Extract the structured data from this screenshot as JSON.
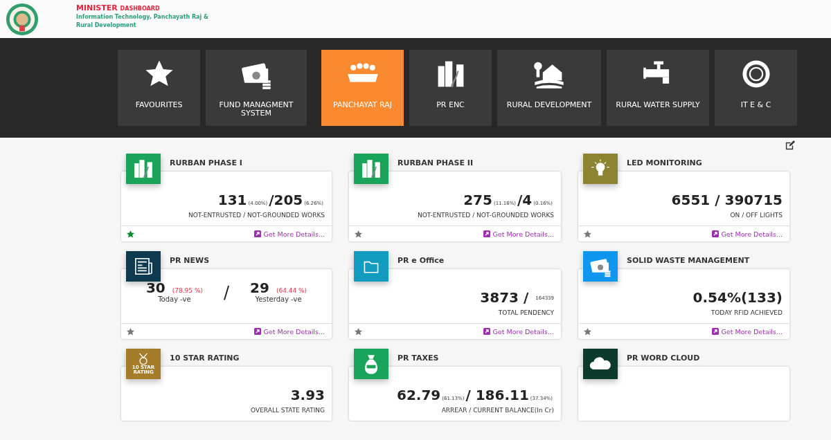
{
  "header": {
    "title": "MINISTER",
    "title_suffix": "DASHBOARD",
    "subtitle": "Information Technology, Panchayath Raj & Rural Development"
  },
  "modules": [
    {
      "label": "FAVOURITES",
      "selected": false
    },
    {
      "label": "FUND MANAGMENT SYSTEM",
      "selected": false
    },
    {
      "label": "PANCHAYAT RAJ",
      "selected": true
    },
    {
      "label": "PR ENC",
      "selected": false
    },
    {
      "label": "RURAL DEVELOPMENT",
      "selected": false
    },
    {
      "label": "RURAL WATER SUPPLY",
      "selected": false
    },
    {
      "label": "IT E & C",
      "selected": false
    }
  ],
  "cards": [
    {
      "title": "RURBAN PHASE I",
      "color": "#1aa45a",
      "figures": [
        {
          "text": "131",
          "kind": "big"
        },
        {
          "text": "(4.00%)",
          "kind": "note"
        },
        {
          "text": "/205",
          "kind": "big"
        },
        {
          "text": "(6.26%)",
          "kind": "note"
        }
      ],
      "caption": "NOT-ENTRUSTED / NOT-GROUNDED WORKS",
      "favourite": true,
      "link": "Get More Details..."
    },
    {
      "title": "RURBAN PHASE II",
      "color": "#1aa45a",
      "figures": [
        {
          "text": "275",
          "kind": "big"
        },
        {
          "text": "(11.16%)",
          "kind": "note"
        },
        {
          "text": "/4",
          "kind": "big"
        },
        {
          "text": "(0.16%)",
          "kind": "note"
        }
      ],
      "caption": "NOT-ENTRUSTED / NOT-GROUNDED WORKS",
      "favourite": false,
      "link": "Get More Details..."
    },
    {
      "title": "LED MONITORING",
      "color": "#8c8430",
      "figures": [
        {
          "text": "6551 / 390715",
          "kind": "big"
        }
      ],
      "caption": "ON / OFF  LIGHTS",
      "favourite": false,
      "link": "Get More Details..."
    },
    {
      "title": "PR NEWS",
      "color": "#0d3a4f",
      "split": [
        {
          "value": "30",
          "percent": "(78.95 %)",
          "label": "Today  -ve"
        },
        {
          "value": "29",
          "percent": "(64.44 %)",
          "label": "Yesterday  -ve"
        }
      ],
      "separator": "/",
      "favourite": false,
      "link": "Get More Details..."
    },
    {
      "title": "PR e Office",
      "color": "#139bc0",
      "figures": [
        {
          "text": "3873 /",
          "kind": "big"
        },
        {
          "text": "164339",
          "kind": "tiny"
        }
      ],
      "caption": "TOTAL PENDENCY",
      "favourite": false,
      "link": "Get More Details..."
    },
    {
      "title": "SOLID WASTE MANAGEMENT",
      "color": "#0f97f0",
      "figures": [
        {
          "text": "0.54%(133)",
          "kind": "big"
        }
      ],
      "caption": "TODAY RFID ACHIEVED",
      "favourite": false,
      "link": "Get More Details..."
    },
    {
      "title": "10 STAR RATING",
      "icon_text": "10 STAR RATING",
      "color": "#a47c2a",
      "figures": [
        {
          "text": "3.93",
          "kind": "big"
        }
      ],
      "caption": "OVERALL STATE RATING"
    },
    {
      "title": "PR TAXES",
      "color": "#1aa45a",
      "figures": [
        {
          "text": "62.79",
          "kind": "big"
        },
        {
          "text": "(61.13%)",
          "kind": "note"
        },
        {
          "text": "/ 186.11",
          "kind": "big"
        },
        {
          "text": "(37.34%)",
          "kind": "note"
        }
      ],
      "caption": "ARREAR  /  CURRENT  BALANCE(In Cr)"
    },
    {
      "title": "PR WORD CLOUD",
      "color": "#0c3b2e"
    }
  ]
}
